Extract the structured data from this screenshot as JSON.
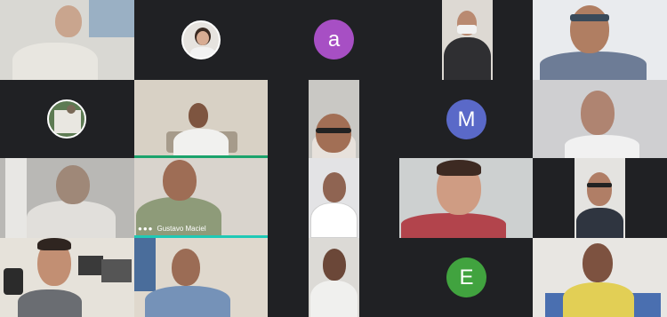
{
  "meeting": {
    "speaker_name": "Gustavo Maciel",
    "more_options_icon": "three-dots-icon"
  },
  "participants": {
    "a": {
      "initial": "a",
      "color": "#a74fc4"
    },
    "m": {
      "initial": "M",
      "color": "#5a69c8"
    },
    "e": {
      "initial": "E",
      "color": "#41a33f"
    }
  }
}
